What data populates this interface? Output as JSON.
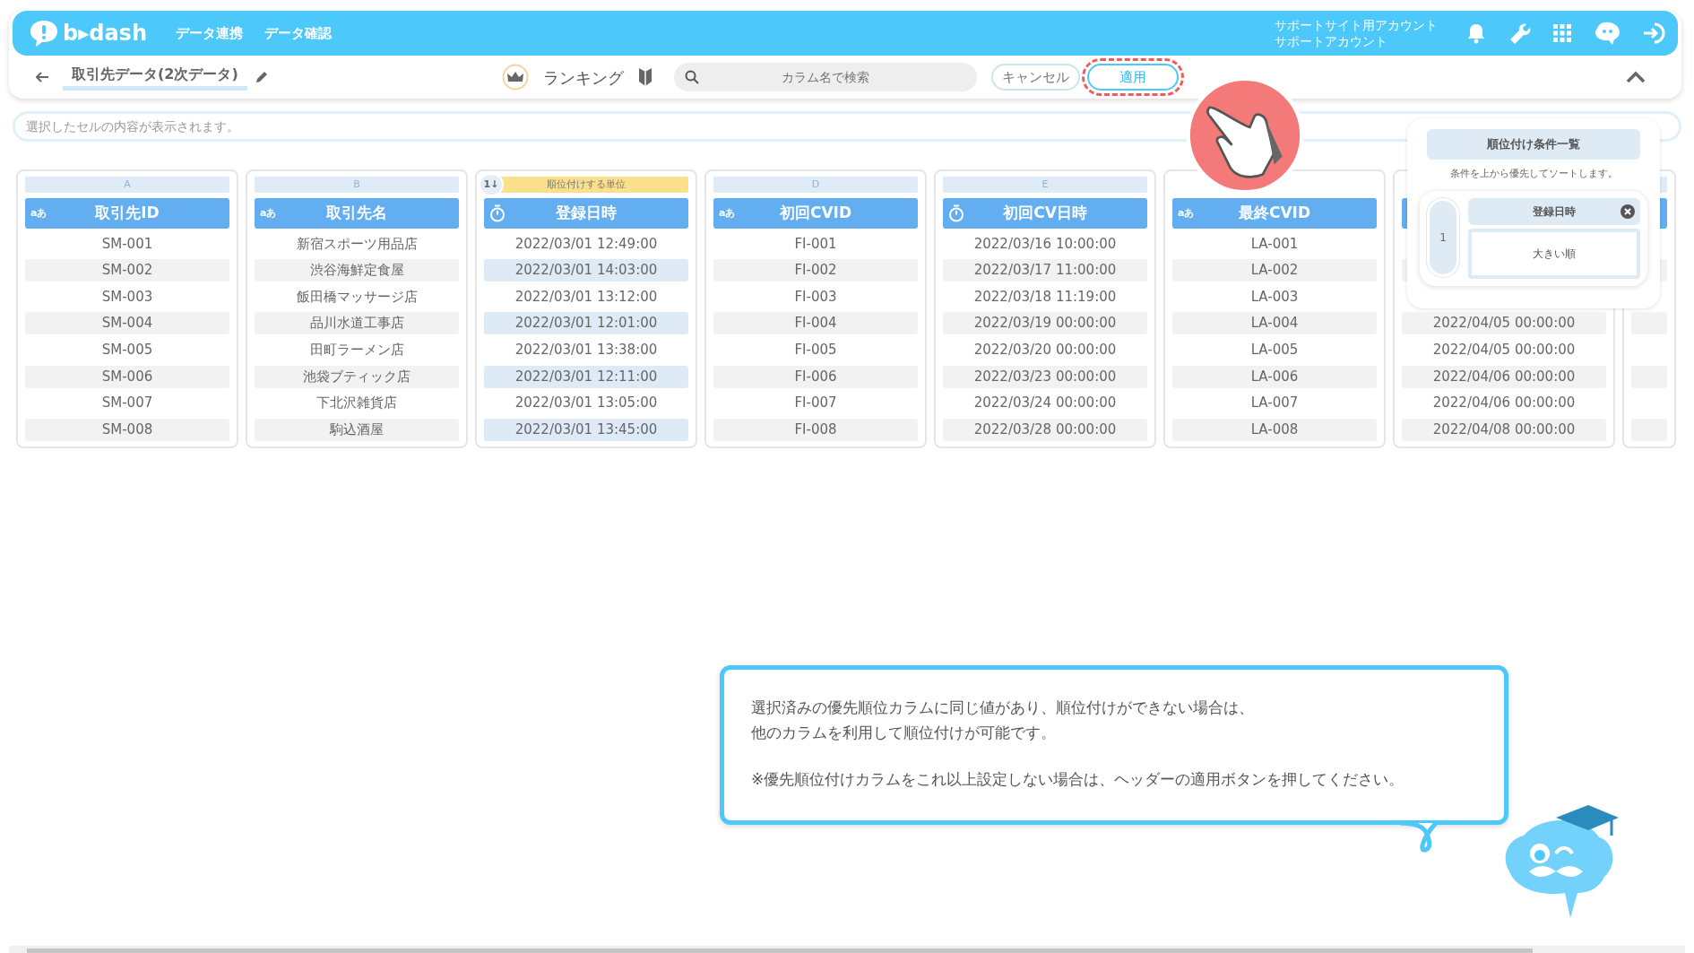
{
  "navbar": {
    "logo": "b▸dash",
    "links": [
      "データ連携",
      "データ確認"
    ],
    "account": [
      "サポートサイト用アカウント",
      "サポートアカウント"
    ]
  },
  "toolbar": {
    "title": "取引先データ(2次データ)",
    "mode": "ランキング",
    "search": {
      "placeholder": "カラム名で検索"
    },
    "buttons": [
      {
        "label": "キャンセル",
        "kind": "cancel",
        "highlighted": false
      },
      {
        "label": "適用",
        "kind": "apply",
        "highlighted": true
      }
    ]
  },
  "cell_bar": {
    "placeholder": "選択したセルの内容が表示されます。"
  },
  "columns": [
    {
      "letter": "A",
      "name": "取引先ID",
      "kind": "text",
      "type_label": "aあ",
      "selected": false,
      "cells": [
        "SM-001",
        "SM-002",
        "SM-003",
        "SM-004",
        "SM-005",
        "SM-006",
        "SM-007",
        "SM-008"
      ]
    },
    {
      "letter": "B",
      "name": "取引先名",
      "kind": "text",
      "type_label": "aあ",
      "selected": false,
      "cells": [
        "新宿スポーツ用品店",
        "渋谷海鮮定食屋",
        "飯田橋マッサージ店",
        "品川水道工事店",
        "田町ラーメン店",
        "池袋ブティック店",
        "下北沢雑貨店",
        "駒込酒屋"
      ]
    },
    {
      "name": "登録日時",
      "kind": "datetime",
      "selected": true,
      "rank_badge": "1↓",
      "rank_label": "順位付けする単位",
      "cells": [
        "2022/03/01 12:49:00",
        "2022/03/01 14:03:00",
        "2022/03/01 13:12:00",
        "2022/03/01 12:01:00",
        "2022/03/01 13:38:00",
        "2022/03/01 12:11:00",
        "2022/03/01 13:05:00",
        "2022/03/01 13:45:00"
      ]
    },
    {
      "letter": "D",
      "name": "初回CVID",
      "kind": "text",
      "type_label": "aあ",
      "selected": false,
      "cells": [
        "FI-001",
        "FI-002",
        "FI-003",
        "FI-004",
        "FI-005",
        "FI-006",
        "FI-007",
        "FI-008"
      ]
    },
    {
      "letter": "E",
      "name": "初回CV日時",
      "kind": "datetime",
      "selected": false,
      "cells": [
        "2022/03/16 10:00:00",
        "2022/03/17 11:00:00",
        "2022/03/18 11:19:00",
        "2022/03/19 00:00:00",
        "2022/03/20 00:00:00",
        "2022/03/23 00:00:00",
        "2022/03/24 00:00:00",
        "2022/03/28 00:00:00"
      ]
    },
    {
      "name": "最終CVID",
      "kind": "text",
      "type_label": "aあ",
      "selected": false,
      "cells": [
        "LA-001",
        "LA-002",
        "LA-003",
        "LA-004",
        "LA-005",
        "LA-006",
        "LA-007",
        "LA-008"
      ]
    },
    {
      "kind": "datetime",
      "selected": false,
      "cells": [
        null,
        null,
        null,
        "2022/04/05 00:00:00",
        "2022/04/05 00:00:00",
        "2022/04/06 00:00:00",
        "2022/04/06 00:00:00",
        "2022/04/08 00:00:00"
      ]
    }
  ],
  "conditions_panel": {
    "title": "順位付け条件一覧",
    "subtitle": "条件を上から優先してソートします。",
    "conditions": [
      {
        "number": "1",
        "column": "登録日時",
        "order": "大きい順"
      }
    ]
  },
  "guide": {
    "paragraphs": [
      [
        "選択済みの優先順位カラムに同じ値があり、順位付けができない場合は、",
        "他のカラムを利用して順位付けが可能です。"
      ],
      [
        "※優先順位付けカラムをこれ以上設定しない場合は、ヘッダーの適用ボタンを押してください。"
      ]
    ]
  }
}
